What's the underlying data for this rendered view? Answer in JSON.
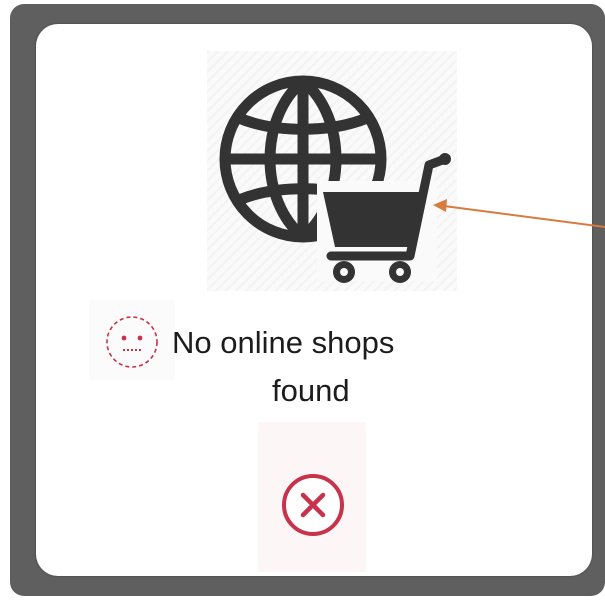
{
  "dialog": {
    "message_line1": "No online shops",
    "message_line2": "found",
    "illustration_icon": "globe-shopping-cart-icon",
    "status_icon": "sad-face-icon",
    "close_icon": "close-circle-icon"
  },
  "colors": {
    "device_bezel": "#5f5f5f",
    "dialog_background": "#ffffff",
    "icon_dark": "#333333",
    "alert_red": "#c8324a",
    "annotation_arrow": "#d77b3f"
  }
}
